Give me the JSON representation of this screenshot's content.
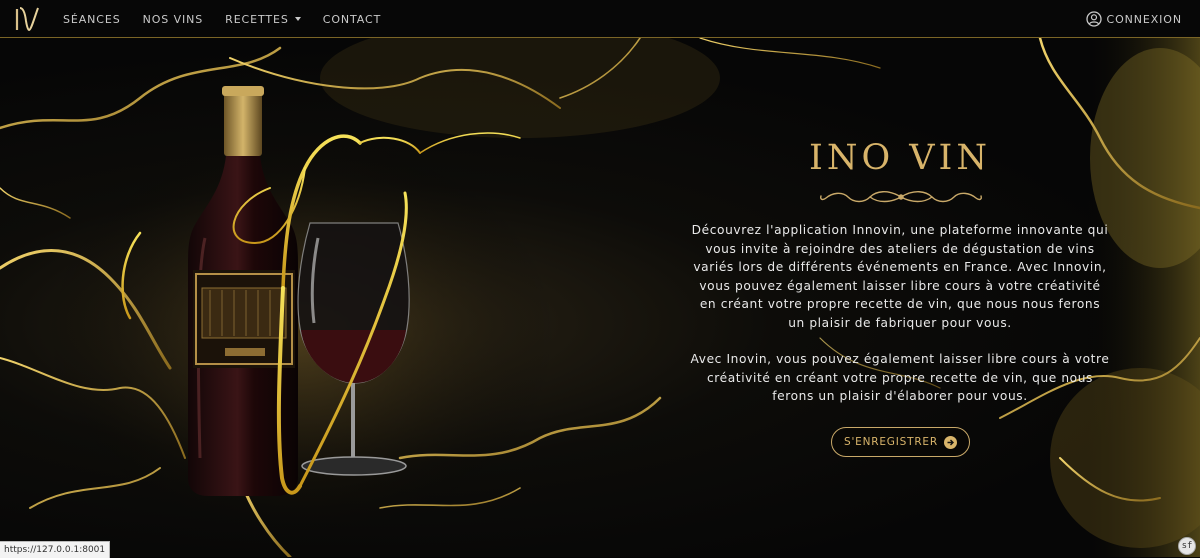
{
  "nav": {
    "logo_letter": "V",
    "links": [
      {
        "label": "SÉANCES"
      },
      {
        "label": "NOS VINS"
      },
      {
        "label": "RECETTES"
      },
      {
        "label": "CONTACT"
      }
    ],
    "login_label": "CONNEXION"
  },
  "hero": {
    "title": "INO VIN",
    "paragraph_1": "Découvrez l'application Innovin, une plateforme innovante qui vous invite à rejoindre des ateliers de dégustation de vins variés lors de différents événements en France. Avec Innovin, vous pouvez également laisser libre cours à votre créativité en créant votre propre recette de vin, que nous nous ferons un plaisir de fabriquer pour vous.",
    "paragraph_2": "Avec Inovin, vous pouvez également laisser libre cours à votre créativité en créant votre propre recette de vin, que nous ferons un plaisir d'élaborer pour vous.",
    "register_label": "S'ENREGISTRER"
  },
  "status": {
    "url": "https://127.0.0.1:8001"
  },
  "colors": {
    "gold": "#d8b46a",
    "background": "#050505",
    "text": "#e9e9e9"
  },
  "icons": {
    "login": "user-circle-icon",
    "register_arrow": "arrow-right-circle-icon",
    "dropdown": "chevron-down-icon"
  }
}
